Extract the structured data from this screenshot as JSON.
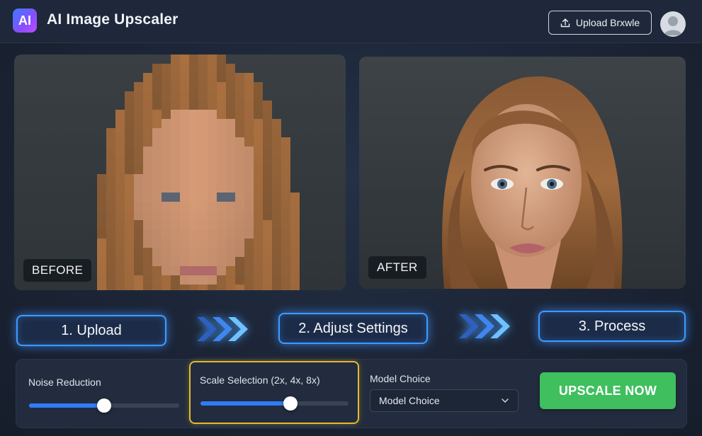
{
  "header": {
    "logo_text": "AI",
    "title": "AI Image Upscaler",
    "upload_label": "Upload Brxwle"
  },
  "panels": {
    "before_label": "BEFORE",
    "after_label": "AFTER"
  },
  "steps": [
    {
      "label": "1. Upload"
    },
    {
      "label": "2. Adjust Settings"
    },
    {
      "label": "3. Process"
    }
  ],
  "settings": {
    "noise_reduction": {
      "label": "Noise Reduction",
      "value_fraction": 0.5
    },
    "scale_selection": {
      "label": "Scale Selection (2x, 4x, 8x)",
      "value_fraction": 0.61
    },
    "model_choice": {
      "label": "Model Choice",
      "selected": "Model Choice"
    },
    "upscale_label": "UPSCALE NOW"
  },
  "colors": {
    "accent_blue": "#2f7cf6",
    "step_glow": "#3f9bff",
    "highlight_yellow": "#e4b92c",
    "upscale_green": "#3fbf5e"
  },
  "icons": [
    "upload-icon",
    "avatar-icon",
    "chevron-down-icon",
    "triple-chevron-right-icon"
  ]
}
